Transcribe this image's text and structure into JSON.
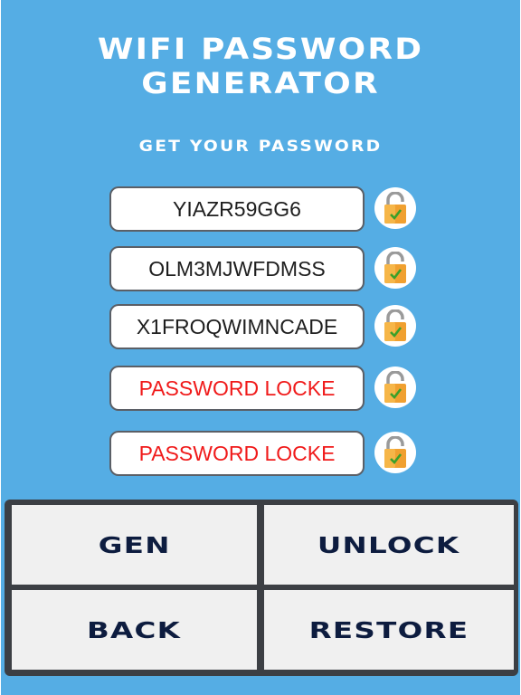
{
  "app": {
    "title_line1": "WIFI PASSWORD",
    "title_line2": "GENERATOR",
    "subtitle": "GET YOUR PASSWORD"
  },
  "passwords": [
    {
      "value": "YIAZR59GG6",
      "locked": false
    },
    {
      "value": "OLM3MJWFDMSS",
      "locked": false
    },
    {
      "value": "X1FROQWIMNCADE",
      "locked": false
    },
    {
      "value": "PASSWORD LOCKE",
      "locked": true
    },
    {
      "value": "PASSWORD LOCKE",
      "locked": true
    }
  ],
  "icons": {
    "lock": "unlocked-padlock-icon"
  },
  "buttons": {
    "gen": "GEN",
    "unlock": "UNLOCK",
    "back": "BACK",
    "restore": "RESTORE"
  },
  "colors": {
    "background": "#55ade4",
    "locked_text": "#f01a1a",
    "button_text": "#0d1c3f",
    "panel_border": "#3c3f44",
    "padlock_body": "#f0a030",
    "check": "#3aa02a"
  }
}
